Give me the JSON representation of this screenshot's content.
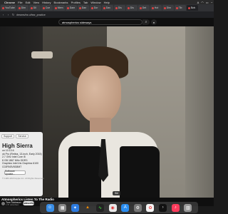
{
  "menubar": {
    "items": [
      "Chrome",
      "File",
      "Edit",
      "View",
      "History",
      "Bookmarks",
      "Profiles",
      "Tab",
      "Window",
      "Help"
    ],
    "right_items": [
      "A",
      "Wi-Fi",
      "Battery",
      "Clock"
    ]
  },
  "browser": {
    "tabs": [
      "YouTube",
      "Dim",
      "Dil",
      "Coe",
      "Mem",
      "Dam",
      "Dan",
      "Dor",
      "Dav",
      "Dis",
      "Dis",
      "Det",
      "Hot",
      "Dim",
      "Tib",
      "Sch"
    ],
    "url": "dreams/tra u/fear_practice"
  },
  "youtube": {
    "search_query": "atmospherics sideways",
    "search_icon": "search-icon",
    "mic_icon": "mic-icon"
  },
  "about_mac": {
    "tabs": [
      "Support",
      "Service"
    ],
    "os_name": "High Sierra",
    "specs": [
      "on 10.13.6",
      "ok Pro (Retina, 13-inch, Early 2015)",
      "2.7 GHz Intel Core i5",
      "8 GB 1867 MHz DDR3",
      "Graphics Intel Iris Graphics 6100",
      "C02RN3V8G8M7"
    ],
    "button_label": "Software Update...",
    "footer": "© 1983-2018 Apple Inc. All Rights Reserved."
  },
  "video": {
    "title": "Atmospherics Listen To The Radio",
    "channel_name": "Tom Tobinson",
    "channel_subs": "1.7K subscribers",
    "subscribe_label": "Subscribe",
    "tooltip": "Siri"
  },
  "dock": {
    "icons": [
      "finder-icon",
      "launchpad-icon",
      "safari-icon",
      "vlc-icon",
      "activity-monitor-icon",
      "chrome-icon",
      "app-store-icon",
      "system-preferences-icon",
      "photos-icon",
      "terminal-icon",
      "music-icon",
      "trash-icon"
    ]
  }
}
